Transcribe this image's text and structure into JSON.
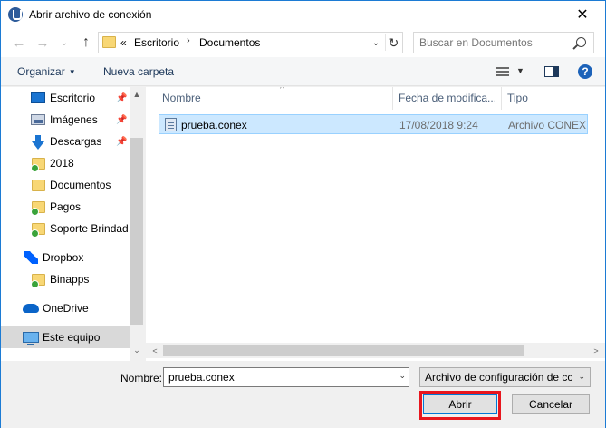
{
  "window": {
    "title": "Abrir archivo de conexión",
    "close_glyph": "✕"
  },
  "nav": {
    "back_glyph": "←",
    "forward_glyph": "→",
    "recent_glyph": "⌄",
    "up_glyph": "↑",
    "breadcrumb_prefix": "«",
    "breadcrumb": [
      "Escritorio",
      "Documentos"
    ],
    "breadcrumb_sep": "›",
    "dropdown_glyph": "⌄",
    "refresh_glyph": "↻",
    "search_placeholder": "Buscar en Documentos"
  },
  "toolbar": {
    "organize_label": "Organizar",
    "organize_caret": "▼",
    "new_folder_label": "Nueva carpeta",
    "view_caret": "▼",
    "help_label": "?"
  },
  "sidebar": {
    "pin_glyph": "📌",
    "items": [
      {
        "label": "Escritorio",
        "icon": "desktop-icon",
        "pinned": true
      },
      {
        "label": "Imágenes",
        "icon": "images-icon",
        "pinned": true
      },
      {
        "label": "Descargas",
        "icon": "downloads-icon",
        "pinned": true
      },
      {
        "label": "2018",
        "icon": "folder-icon"
      },
      {
        "label": "Documentos",
        "icon": "folder-icon"
      },
      {
        "label": "Pagos",
        "icon": "folder-icon"
      },
      {
        "label": "Soporte Brindad",
        "icon": "folder-icon"
      },
      {
        "label": "Dropbox",
        "icon": "dropbox-icon"
      },
      {
        "label": "Binapps",
        "icon": "folder-icon"
      },
      {
        "label": "OneDrive",
        "icon": "onedrive-icon"
      },
      {
        "label": "Este equipo",
        "icon": "computer-icon",
        "selected": true
      }
    ],
    "scroll_up_glyph": "▲",
    "scroll_down_glyph": "⌄"
  },
  "file_list": {
    "columns": [
      "Nombre",
      "Fecha de modifica...",
      "Tipo"
    ],
    "sort_glyph": "^",
    "rows": [
      {
        "name": "prueba.conex",
        "modified": "17/08/2018 9:24",
        "type": "Archivo CONEX",
        "selected": true
      }
    ],
    "h_scroll_left_glyph": "<",
    "h_scroll_right_glyph": ">"
  },
  "footer": {
    "name_label": "Nombre:",
    "name_value": "prueba.conex",
    "name_caret": "⌄",
    "file_type_value": "Archivo de configuración de cc",
    "file_type_caret": "⌄",
    "open_label": "Abrir",
    "cancel_label": "Cancelar",
    "highlight_color": "#e8161e"
  }
}
